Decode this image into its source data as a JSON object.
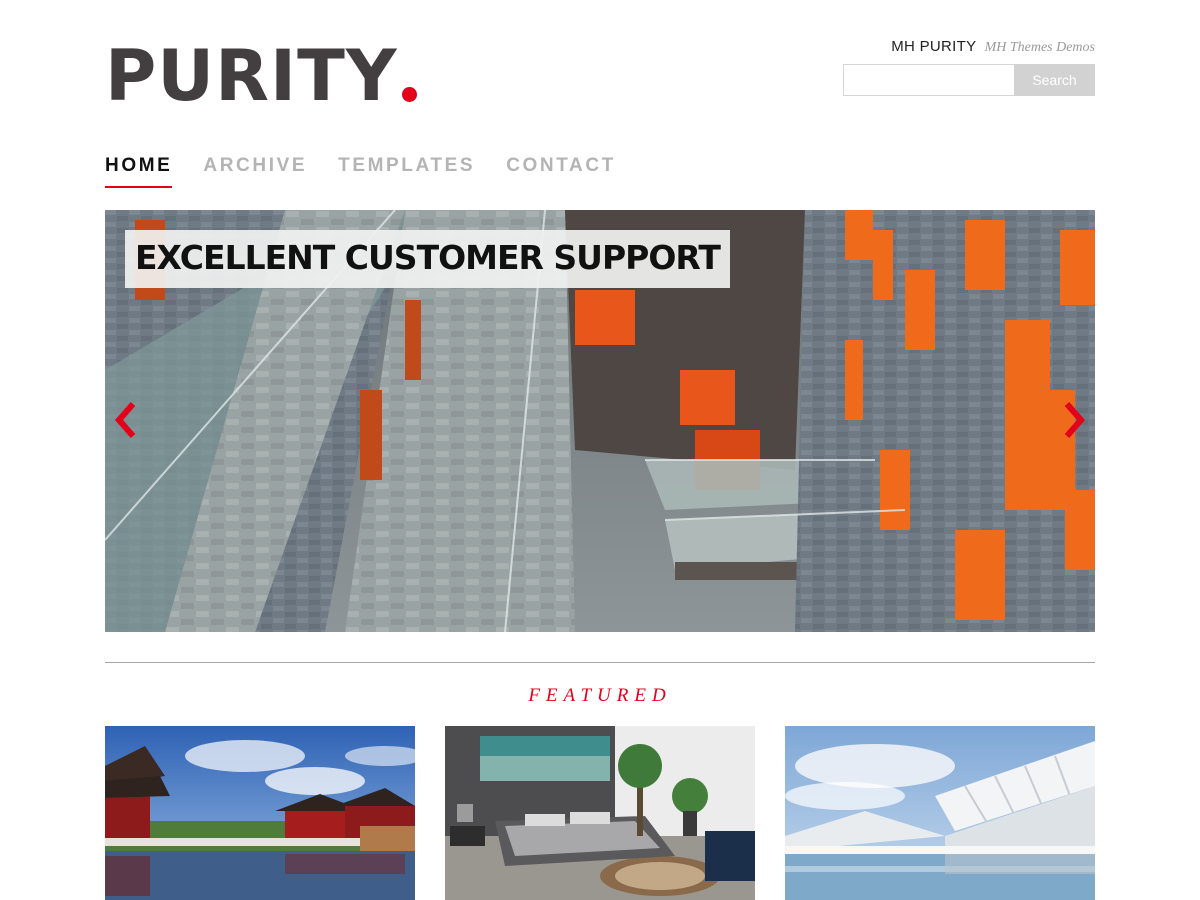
{
  "header": {
    "logo_text": "PURITY",
    "site_name": "MH PURITY",
    "site_description": "MH Themes Demos",
    "search_placeholder": "",
    "search_button": "Search"
  },
  "nav": {
    "items": [
      {
        "label": "HOME",
        "active": true
      },
      {
        "label": "ARCHIVE",
        "active": false
      },
      {
        "label": "TEMPLATES",
        "active": false
      },
      {
        "label": "CONTACT",
        "active": false
      }
    ]
  },
  "slider": {
    "caption": "EXCELLENT CUSTOMER SUPPORT",
    "prev_icon": "chevron-left-icon",
    "next_icon": "chevron-right-icon"
  },
  "featured": {
    "title": "FEATURED",
    "items": [
      {
        "image": "chinese-garden-pagoda"
      },
      {
        "image": "modern-bedroom-interior"
      },
      {
        "image": "futuristic-white-architecture"
      }
    ]
  },
  "colors": {
    "accent": "#e3001b",
    "logo": "#433f40",
    "nav_inactive": "#b4b4b4",
    "search_button": "#d2d2d2"
  }
}
